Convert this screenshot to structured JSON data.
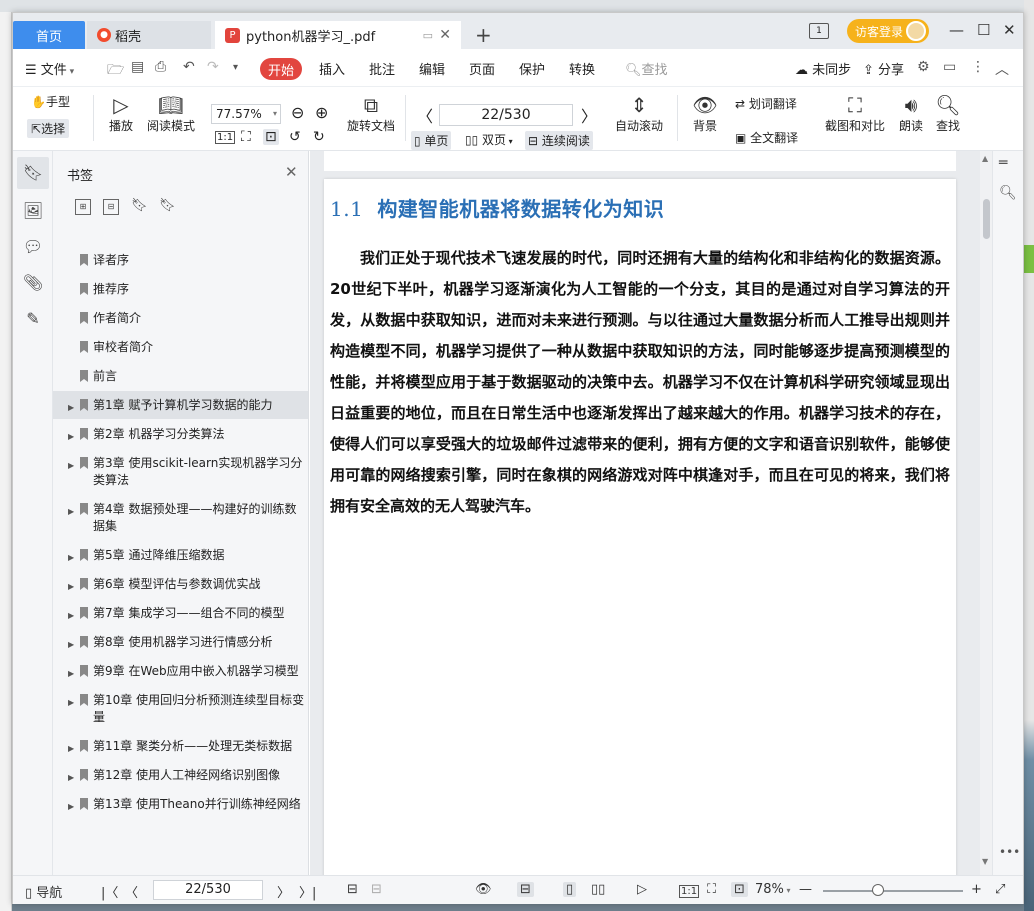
{
  "tabs": {
    "home": "首页",
    "docer": "稻壳",
    "pdf": "python机器学习_.pdf",
    "new": "+"
  },
  "titlebar": {
    "visitor_login": "访客登录",
    "layout_badge": "1"
  },
  "menu": {
    "file": "文件",
    "start": "开始",
    "insert": "插入",
    "annotate": "批注",
    "edit": "编辑",
    "page": "页面",
    "protect": "保护",
    "convert": "转换",
    "search": "查找",
    "unsynced": "未同步",
    "share": "分享"
  },
  "ribbon": {
    "hand": "手型",
    "select": "选择",
    "play": "播放",
    "read_mode": "阅读模式",
    "zoom": "77.57%",
    "rotate_doc": "旋转文档",
    "page_input": "22/530",
    "single": "单页",
    "double": "双页",
    "continuous": "连续阅读",
    "auto_scroll": "自动滚动",
    "background": "背景",
    "word_translate": "划词翻译",
    "full_translate": "全文翻译",
    "screenshot_compare": "截图和对比",
    "read_aloud": "朗读",
    "find": "查找"
  },
  "sidebar": {
    "title": "书签",
    "items": [
      {
        "label": "译者序",
        "expandable": false
      },
      {
        "label": "推荐序",
        "expandable": false
      },
      {
        "label": "作者简介",
        "expandable": false
      },
      {
        "label": "审校者简介",
        "expandable": false
      },
      {
        "label": "前言",
        "expandable": false
      },
      {
        "label": "第1章 赋予计算机学习数据的能力",
        "expandable": true
      },
      {
        "label": "第2章 机器学习分类算法",
        "expandable": true
      },
      {
        "label": "第3章 使用scikit-learn实现机器学习分类算法",
        "expandable": true
      },
      {
        "label": "第4章 数据预处理——构建好的训练数据集",
        "expandable": true
      },
      {
        "label": "第5章 通过降维压缩数据",
        "expandable": true
      },
      {
        "label": "第6章 模型评估与参数调优实战",
        "expandable": true
      },
      {
        "label": "第7章 集成学习——组合不同的模型",
        "expandable": true
      },
      {
        "label": "第8章 使用机器学习进行情感分析",
        "expandable": true
      },
      {
        "label": "第9章 在Web应用中嵌入机器学习模型",
        "expandable": true
      },
      {
        "label": "第10章 使用回归分析预测连续型目标变量",
        "expandable": true
      },
      {
        "label": "第11章 聚类分析——处理无类标数据",
        "expandable": true
      },
      {
        "label": "第12章 使用人工神经网络识别图像",
        "expandable": true
      },
      {
        "label": "第13章 使用Theano并行训练神经网络",
        "expandable": true
      }
    ]
  },
  "document": {
    "section_number": "1.1",
    "section_title": "构建智能机器将数据转化为知识",
    "paragraph": "我们正处于现代技术飞速发展的时代，同时还拥有大量的结构化和非结构化的数据资源。20世纪下半叶，机器学习逐渐演化为人工智能的一个分支，其目的是通过对自学习算法的开发，从数据中获取知识，进而对未来进行预测。与以往通过大量数据分析而人工推导出规则并构造模型不同，机器学习提供了一种从数据中获取知识的方法，同时能够逐步提高预测模型的性能，并将模型应用于基于数据驱动的决策中去。机器学习不仅在计算机科学研究领域显现出日益重要的地位，而且在日常生活中也逐渐发挥出了越来越大的作用。机器学习技术的存在，使得人们可以享受强大的垃圾邮件过滤带来的便利，拥有方便的文字和语音识别软件，能够使用可靠的网络搜索引擎，同时在象棋的网络游戏对阵中棋逢对手，而且在可见的将来，我们将拥有安全高效的无人驾驶汽车。"
  },
  "status": {
    "nav": "导航",
    "page": "22/530",
    "zoom": "78%"
  }
}
